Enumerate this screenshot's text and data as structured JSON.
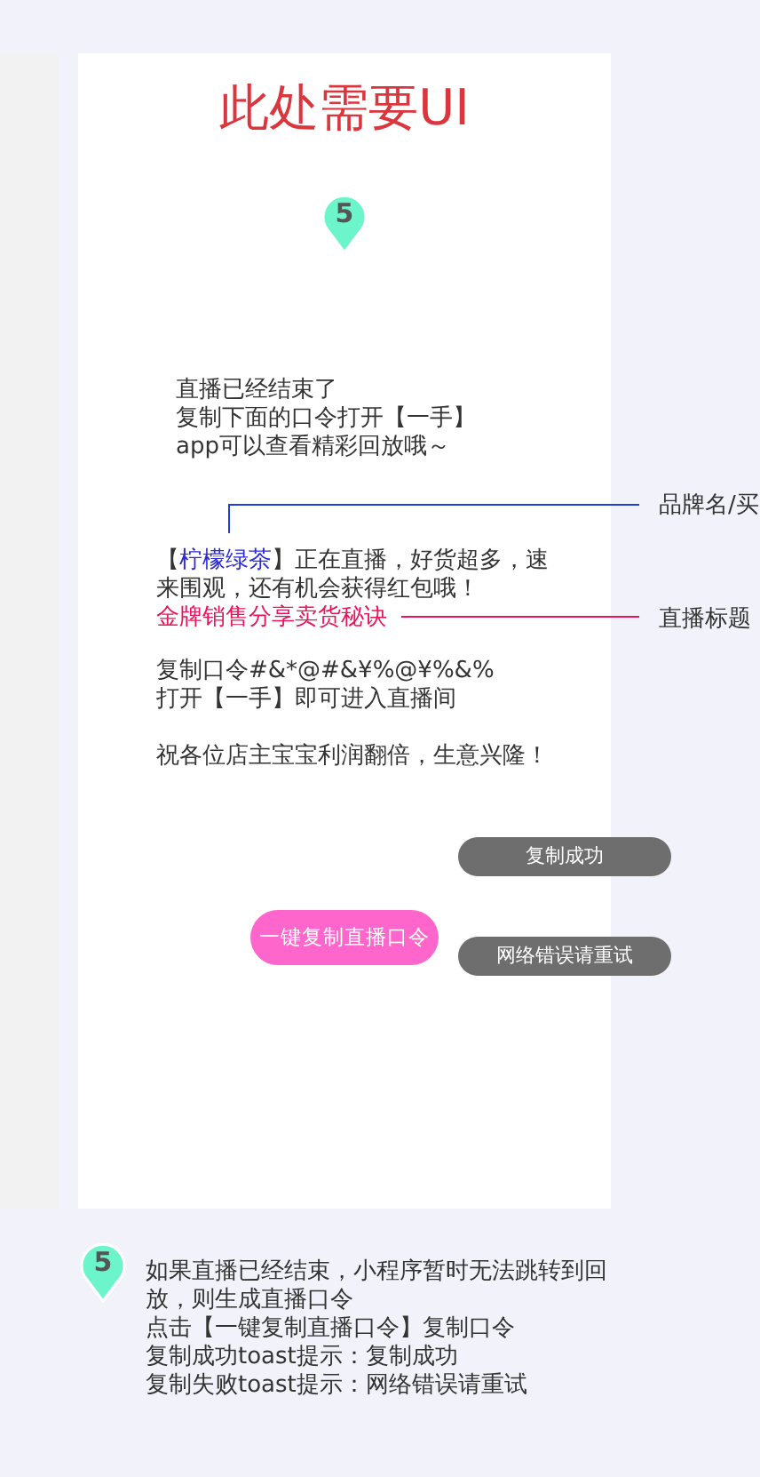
{
  "phone": {
    "title": "此处需要UI",
    "step": "5",
    "ended_message": [
      "直播已经结束了",
      "复制下面的口令打开【一手】",
      "app可以查看精彩回放哦～"
    ],
    "share": {
      "open_bracket": "【",
      "brand": "柠檬绿茶",
      "intro": "】正在直播，好货超多，速来围观，还有机会获得红包哦！",
      "live_title": "金牌销售分享卖货秘诀",
      "code_lines": [
        "复制口令#&*@#&¥%@¥%&%",
        "打开【一手】即可进入直播间"
      ],
      "blessing": "祝各位店主宝宝利润翻倍，生意兴隆！"
    },
    "copy_button": "一键复制直播口令"
  },
  "annotations": [
    {
      "label": "品牌名/买",
      "color": "#1f3fd6"
    },
    {
      "label": "直播标题",
      "color": "#e8155a"
    }
  ],
  "toasts": [
    "复制成功",
    "网络错误请重试"
  ],
  "note": {
    "step": "5",
    "lines": [
      "如果直播已经结束，小程序暂时无法跳转到回放，则生成直播口令",
      "点击【一键复制直播口令】复制口令",
      "复制成功toast提示：复制成功",
      "复制失败toast提示：网络错误请重试"
    ]
  }
}
